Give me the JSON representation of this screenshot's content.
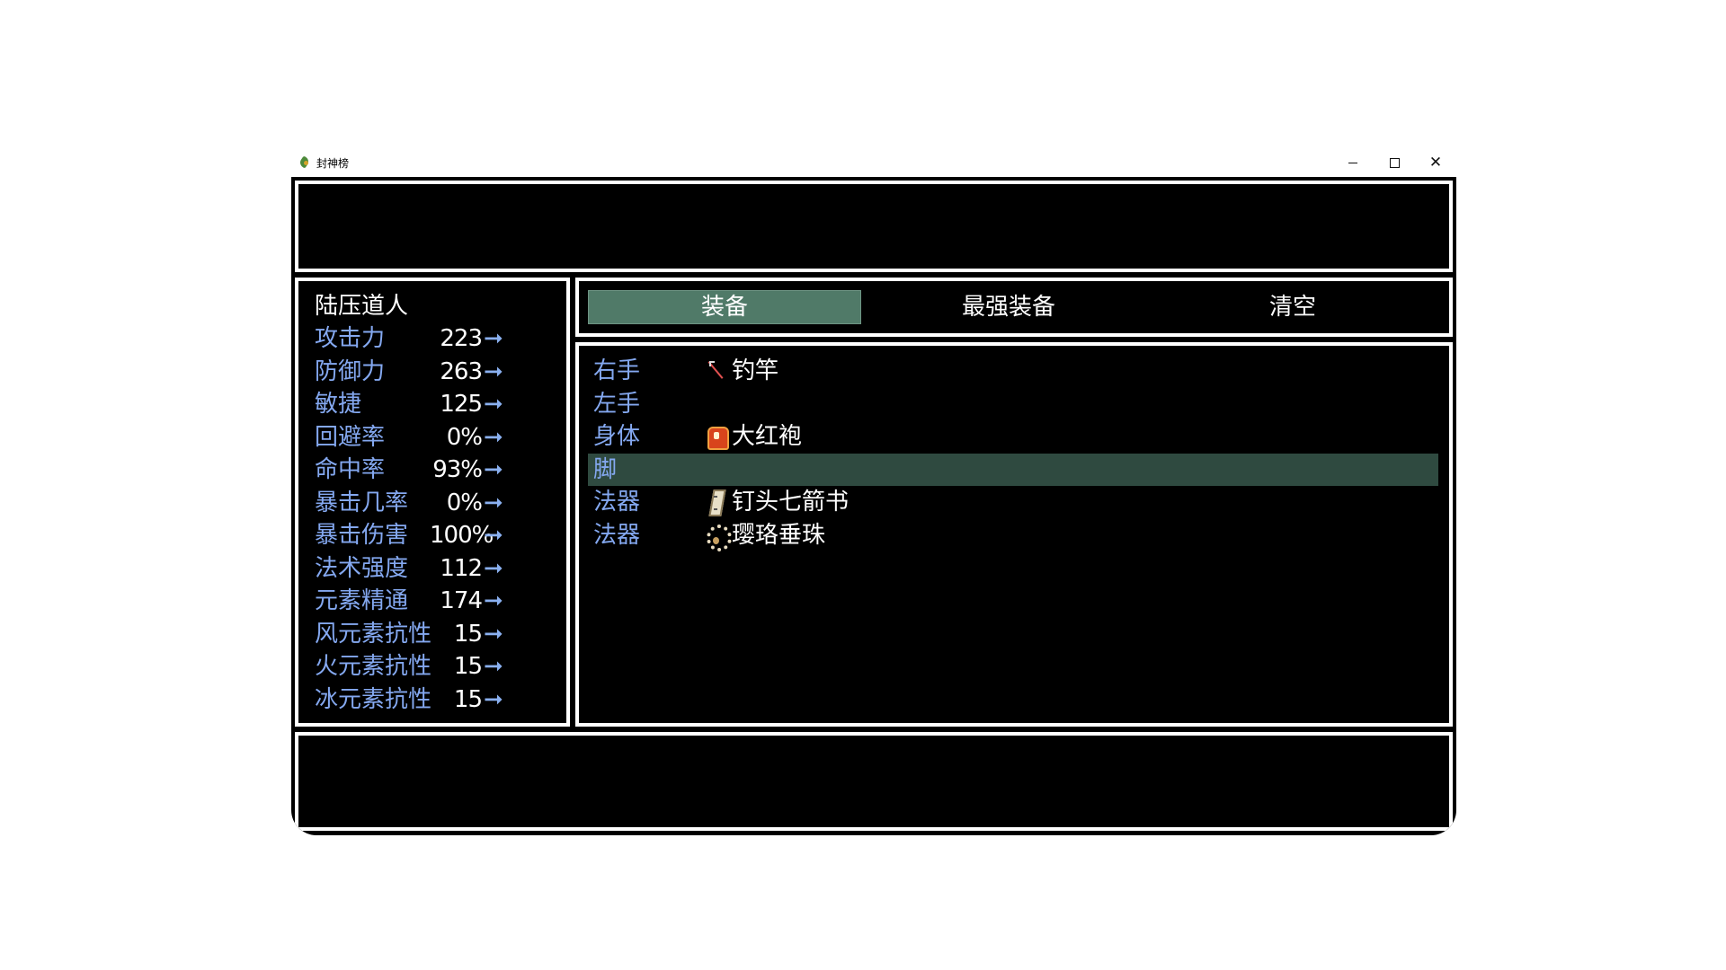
{
  "window": {
    "title": "封神榜",
    "minimize_label": "",
    "maximize_label": "",
    "close_label": "✕"
  },
  "actor": {
    "name": "陆压道人"
  },
  "stats": [
    {
      "label": "攻击力",
      "value": "223",
      "arrow": "➞"
    },
    {
      "label": "防御力",
      "value": "263",
      "arrow": "➞"
    },
    {
      "label": "敏捷",
      "value": "125",
      "arrow": "➞"
    },
    {
      "label": "回避率",
      "value": "0%",
      "arrow": "➞"
    },
    {
      "label": "命中率",
      "value": "93%",
      "arrow": "➞"
    },
    {
      "label": "暴击几率",
      "value": "0%",
      "arrow": "➞"
    },
    {
      "label": "暴击伤害",
      "value": "100%",
      "arrow": "➞"
    },
    {
      "label": "法术强度",
      "value": "112",
      "arrow": "➞"
    },
    {
      "label": "元素精通",
      "value": "174",
      "arrow": "➞"
    },
    {
      "label": "风元素抗性",
      "value": "15",
      "arrow": "➞"
    },
    {
      "label": "火元素抗性",
      "value": "15",
      "arrow": "➞"
    },
    {
      "label": "冰元素抗性",
      "value": "15",
      "arrow": "➞"
    }
  ],
  "commands": {
    "equip": "装备",
    "optimize": "最强装备",
    "clear": "清空",
    "selected": "equip"
  },
  "slots": [
    {
      "label": "右手",
      "item": "钓竿",
      "icon": "fishing-rod-icon"
    },
    {
      "label": "左手",
      "item": "",
      "icon": ""
    },
    {
      "label": "身体",
      "item": "大红袍",
      "icon": "red-robe-icon"
    },
    {
      "label": "脚",
      "item": "",
      "icon": ""
    },
    {
      "label": "法器",
      "item": "钉头七箭书",
      "icon": "scroll-book-icon"
    },
    {
      "label": "法器",
      "item": "璎珞垂珠",
      "icon": "bead-necklace-icon"
    }
  ],
  "selected_slot": 3,
  "colors": {
    "system_blue": "#84a8f0",
    "text": "#ffffff",
    "cursor": "#507a68",
    "row_highlight": "#2f4a40",
    "panel_bg": "#000000",
    "frame": "#ffffff"
  }
}
